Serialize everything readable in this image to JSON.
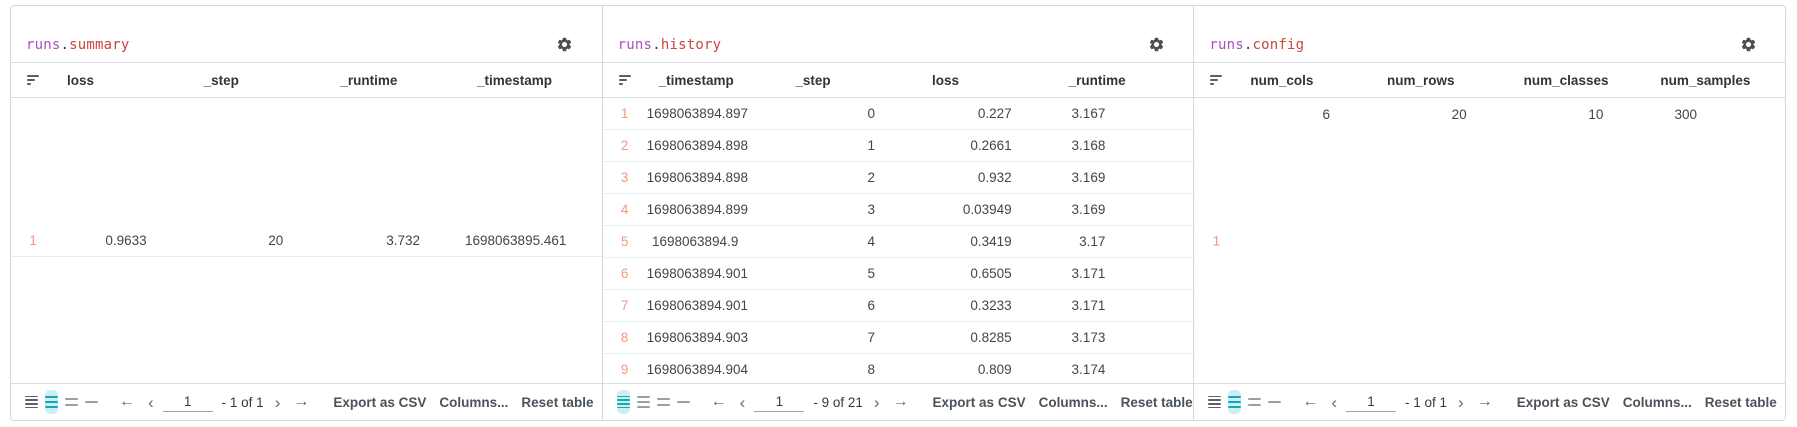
{
  "footer_common": {
    "export_label": "Export as CSV",
    "columns_label": "Columns...",
    "reset_label": "Reset table"
  },
  "colors": {
    "title_object": "#aa4fc7",
    "title_property": "#c9473d",
    "row_index": "#f09a7a",
    "density_selected": "#13a9b8",
    "density_selected_bg": "#cdeef2"
  },
  "panels": [
    {
      "title": {
        "object": "runs",
        "dot": ".",
        "property": "summary"
      },
      "columns": [
        "loss",
        "_step",
        "_runtime",
        "_timestamp"
      ],
      "rows": [
        {
          "index": "1",
          "cells": [
            "0.9633",
            "20",
            "3.732",
            "1698063895.461"
          ]
        }
      ],
      "footer": {
        "page": "1",
        "range_label": "- 1 of 1",
        "selected_density": "3-line"
      }
    },
    {
      "title": {
        "object": "runs",
        "dot": ".",
        "property": "history"
      },
      "columns": [
        "_timestamp",
        "_step",
        "loss",
        "_runtime"
      ],
      "rows": [
        {
          "index": "1",
          "cells": [
            "1698063894.897",
            "0",
            "0.227",
            "3.167"
          ]
        },
        {
          "index": "2",
          "cells": [
            "1698063894.898",
            "1",
            "0.2661",
            "3.168"
          ]
        },
        {
          "index": "3",
          "cells": [
            "1698063894.898",
            "2",
            "0.932",
            "3.169"
          ]
        },
        {
          "index": "4",
          "cells": [
            "1698063894.899",
            "3",
            "0.03949",
            "3.169"
          ]
        },
        {
          "index": "5",
          "cells": [
            "1698063894.9",
            "4",
            "0.3419",
            "3.17"
          ]
        },
        {
          "index": "6",
          "cells": [
            "1698063894.901",
            "5",
            "0.6505",
            "3.171"
          ]
        },
        {
          "index": "7",
          "cells": [
            "1698063894.901",
            "6",
            "0.3233",
            "3.171"
          ]
        },
        {
          "index": "8",
          "cells": [
            "1698063894.903",
            "7",
            "0.8285",
            "3.173"
          ]
        },
        {
          "index": "9",
          "cells": [
            "1698063894.904",
            "8",
            "0.809",
            "3.174"
          ]
        }
      ],
      "footer": {
        "page": "1",
        "range_label": "- 9 of 21",
        "selected_density": "4-line"
      }
    },
    {
      "title": {
        "object": "runs",
        "dot": ".",
        "property": "config"
      },
      "columns": [
        "num_cols",
        "num_rows",
        "num_classes",
        "num_samples"
      ],
      "rows": [
        {
          "index": "1",
          "cells": [
            "6",
            "20",
            "10",
            "300"
          ]
        }
      ],
      "footer": {
        "page": "1",
        "range_label": "- 1 of 1",
        "selected_density": "3-line"
      }
    }
  ]
}
